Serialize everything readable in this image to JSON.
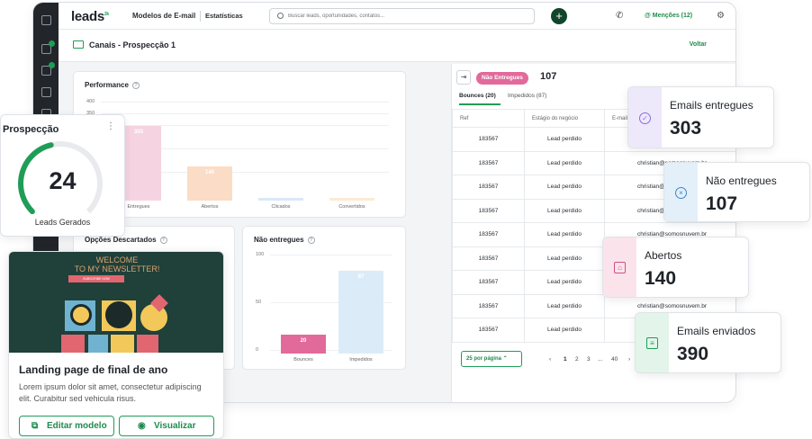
{
  "topbar": {
    "logo": "leads",
    "logo_mark": "2k",
    "nav_templates": "Modelos de E-mail",
    "nav_stats": "Estatísticas",
    "search_placeholder": "Buscar leads, oportunidades, contatos...",
    "mentions": "Menções (12)"
  },
  "header": {
    "title": "Canais - Prospecção 1",
    "back_label": "Voltar"
  },
  "performance": {
    "title": "Performance",
    "y_ticks": [
      "400",
      "350",
      "300"
    ]
  },
  "bottom_left_card": {
    "title": "Opções Descartados"
  },
  "nao_entregues_card": {
    "title": "Não entregues"
  },
  "chart_data": [
    {
      "type": "bar",
      "title": "Performance",
      "categories": [
        "Entregues",
        "Abertos",
        "Clicados",
        "Convertidos"
      ],
      "values": [
        303,
        140,
        10,
        7
      ],
      "value_labels": [
        "303",
        "140",
        "",
        ""
      ],
      "ylim": [
        0,
        400
      ],
      "colors": [
        "#f6d3e1",
        "#fbdcc6",
        "#d9e8f8",
        "#fde9d5"
      ]
    },
    {
      "type": "bar",
      "title": "Não entregues",
      "categories": [
        "Bounces",
        "Impedidos"
      ],
      "values": [
        20,
        87
      ],
      "value_labels": [
        "20",
        "87"
      ],
      "y_ticks": [
        "100",
        "50",
        "0"
      ],
      "ylim": [
        0,
        100
      ],
      "colors": [
        "#e26a9b",
        "#dbecf8"
      ]
    }
  ],
  "panel": {
    "filter_pill": "Não Entregues",
    "count": "107",
    "tab_bounces": "Bounces (20)",
    "tab_impedidos": "Impedidos (87)",
    "columns": [
      "Ref",
      "Estágio do negócio",
      "E-mail do destinatário"
    ],
    "rows": [
      [
        "183567",
        "Lead perdido",
        "christian@somosnuvem.br"
      ],
      [
        "183567",
        "Lead perdido",
        "christian@somosnuvem.br"
      ],
      [
        "183567",
        "Lead perdido",
        "christian@somosnuvem.br"
      ],
      [
        "183567",
        "Lead perdido",
        "christian@somosnuvem.br"
      ],
      [
        "183567",
        "Lead perdido",
        "christian@somosnuvem.br"
      ],
      [
        "183567",
        "Lead perdido",
        "christian@somosnuvem.br"
      ],
      [
        "183567",
        "Lead perdido",
        "christian@somosnuvem.br"
      ],
      [
        "183567",
        "Lead perdido",
        "christian@somosnuvem.br"
      ],
      [
        "183567",
        "Lead perdido",
        "christian@somosnuvem.br"
      ]
    ],
    "per_page": "25 por página",
    "pages": [
      "1",
      "2",
      "3",
      "...",
      "40"
    ]
  },
  "stats": [
    {
      "title": "Emails entregues",
      "value": "303",
      "color": "#8a6bd8",
      "bg": "#eee8fb",
      "icon": "check-circle-icon"
    },
    {
      "title": "Não entregues",
      "value": "107",
      "color": "#3d86c9",
      "bg": "#e3eff9",
      "icon": "x-circle-icon"
    },
    {
      "title": "Abertos",
      "value": "140",
      "color": "#d04f86",
      "bg": "#fbe3ec",
      "icon": "open-envelope-icon"
    },
    {
      "title": "Emails enviados",
      "value": "390",
      "color": "#1f9d57",
      "bg": "#e3f5ea",
      "icon": "send-mail-icon"
    }
  ],
  "prospeccao": {
    "title": "Prospecção",
    "value": "24",
    "label": "Leads Gerados",
    "progress": 0.45
  },
  "newsletter": {
    "banner_title": "WELCOME\nTO MY NEWSLETTER!",
    "banner_button": "SUBSCRIBE NOW",
    "title": "Landing page de final de ano",
    "description": "Lorem ipsum dolor sit amet, consectetur adipiscing elit. Curabitur sed vehicula risus.",
    "edit_label": "Editar modelo",
    "view_label": "Visualizar"
  }
}
